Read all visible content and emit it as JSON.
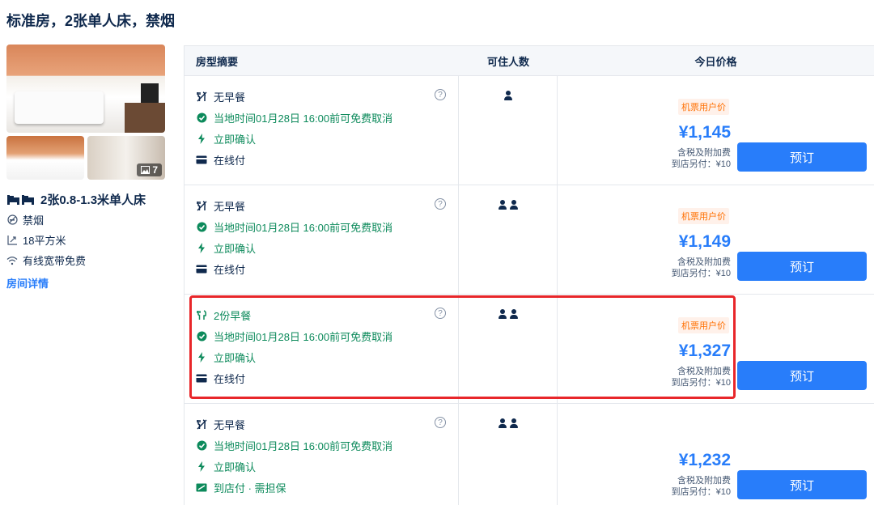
{
  "room_title": "标准房，2张单人床，禁烟",
  "photos": {
    "count": "7"
  },
  "bed": "2张0.8-1.3米单人床",
  "features": [
    "禁烟",
    "18平方米",
    "有线宽带免费"
  ],
  "room_detail_link": "房间详情",
  "table_headers": {
    "summary": "房型摘要",
    "occupancy": "可住人数",
    "price": "今日价格"
  },
  "rows": [
    {
      "meal": "无早餐",
      "meal_green": false,
      "cancel": "当地时间01月28日 16:00前可免费取消",
      "confirm": "立即确认",
      "payment": "在线付",
      "persons": 1,
      "tag": "机票用户价",
      "price": "¥1,145",
      "tax": "含税及附加费",
      "extra": "到店另付：¥10",
      "button": "预订"
    },
    {
      "meal": "无早餐",
      "meal_green": false,
      "cancel": "当地时间01月28日 16:00前可免费取消",
      "confirm": "立即确认",
      "payment": "在线付",
      "persons": 2,
      "tag": "机票用户价",
      "price": "¥1,149",
      "tax": "含税及附加费",
      "extra": "到店另付：¥10",
      "button": "预订"
    },
    {
      "meal": "2份早餐",
      "meal_green": true,
      "cancel": "当地时间01月28日 16:00前可免费取消",
      "confirm": "立即确认",
      "payment": "在线付",
      "persons": 2,
      "tag": "机票用户价",
      "price": "¥1,327",
      "tax": "含税及附加费",
      "extra": "到店另付：¥10",
      "button": "预订"
    },
    {
      "meal": "无早餐",
      "meal_green": false,
      "cancel": "当地时间01月28日 16:00前可免费取消",
      "confirm": "立即确认",
      "payment": "到店付 · 需担保",
      "payment_green": true,
      "persons": 2,
      "tag": "",
      "price": "¥1,232",
      "tax": "含税及附加费",
      "extra": "到店另付：¥10",
      "button": "预订"
    }
  ]
}
